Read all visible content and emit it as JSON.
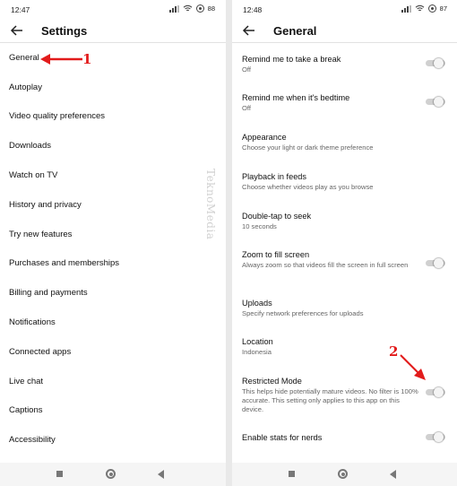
{
  "left_screen": {
    "status_time": "12:47",
    "battery": "88",
    "title": "Settings",
    "items": [
      {
        "label": "General"
      },
      {
        "label": "Autoplay"
      },
      {
        "label": "Video quality preferences"
      },
      {
        "label": "Downloads"
      },
      {
        "label": "Watch on TV"
      },
      {
        "label": "History and privacy"
      },
      {
        "label": "Try new features"
      },
      {
        "label": "Purchases and memberships"
      },
      {
        "label": "Billing and payments"
      },
      {
        "label": "Notifications"
      },
      {
        "label": "Connected apps"
      },
      {
        "label": "Live chat"
      },
      {
        "label": "Captions"
      },
      {
        "label": "Accessibility"
      }
    ]
  },
  "right_screen": {
    "status_time": "12:48",
    "battery": "87",
    "title": "General",
    "items": [
      {
        "title": "Remind me to take a break",
        "subtitle": "Off",
        "toggle": false
      },
      {
        "title": "Remind me when it's bedtime",
        "subtitle": "Off",
        "toggle": false
      },
      {
        "title": "Appearance",
        "subtitle": "Choose your light or dark theme preference"
      },
      {
        "title": "Playback in feeds",
        "subtitle": "Choose whether videos play as you browse"
      },
      {
        "title": "Double-tap to seek",
        "subtitle": "10 seconds"
      },
      {
        "title": "Zoom to fill screen",
        "subtitle": "Always zoom so that videos fill the screen in full screen",
        "toggle": false
      },
      {
        "title": "Uploads",
        "subtitle": "Specify network preferences for uploads"
      },
      {
        "title": "Location",
        "subtitle": "Indonesia"
      },
      {
        "title": "Restricted Mode",
        "subtitle": "This helps hide potentially mature videos. No filter is 100% accurate. This setting only applies to this app on this device.",
        "toggle": false
      },
      {
        "title": "Enable stats for nerds",
        "subtitle": "",
        "toggle": false
      }
    ]
  },
  "annotations": {
    "label_1": "1",
    "label_2": "2",
    "color": "#e21b1b"
  },
  "watermark": "TeknoMedia"
}
